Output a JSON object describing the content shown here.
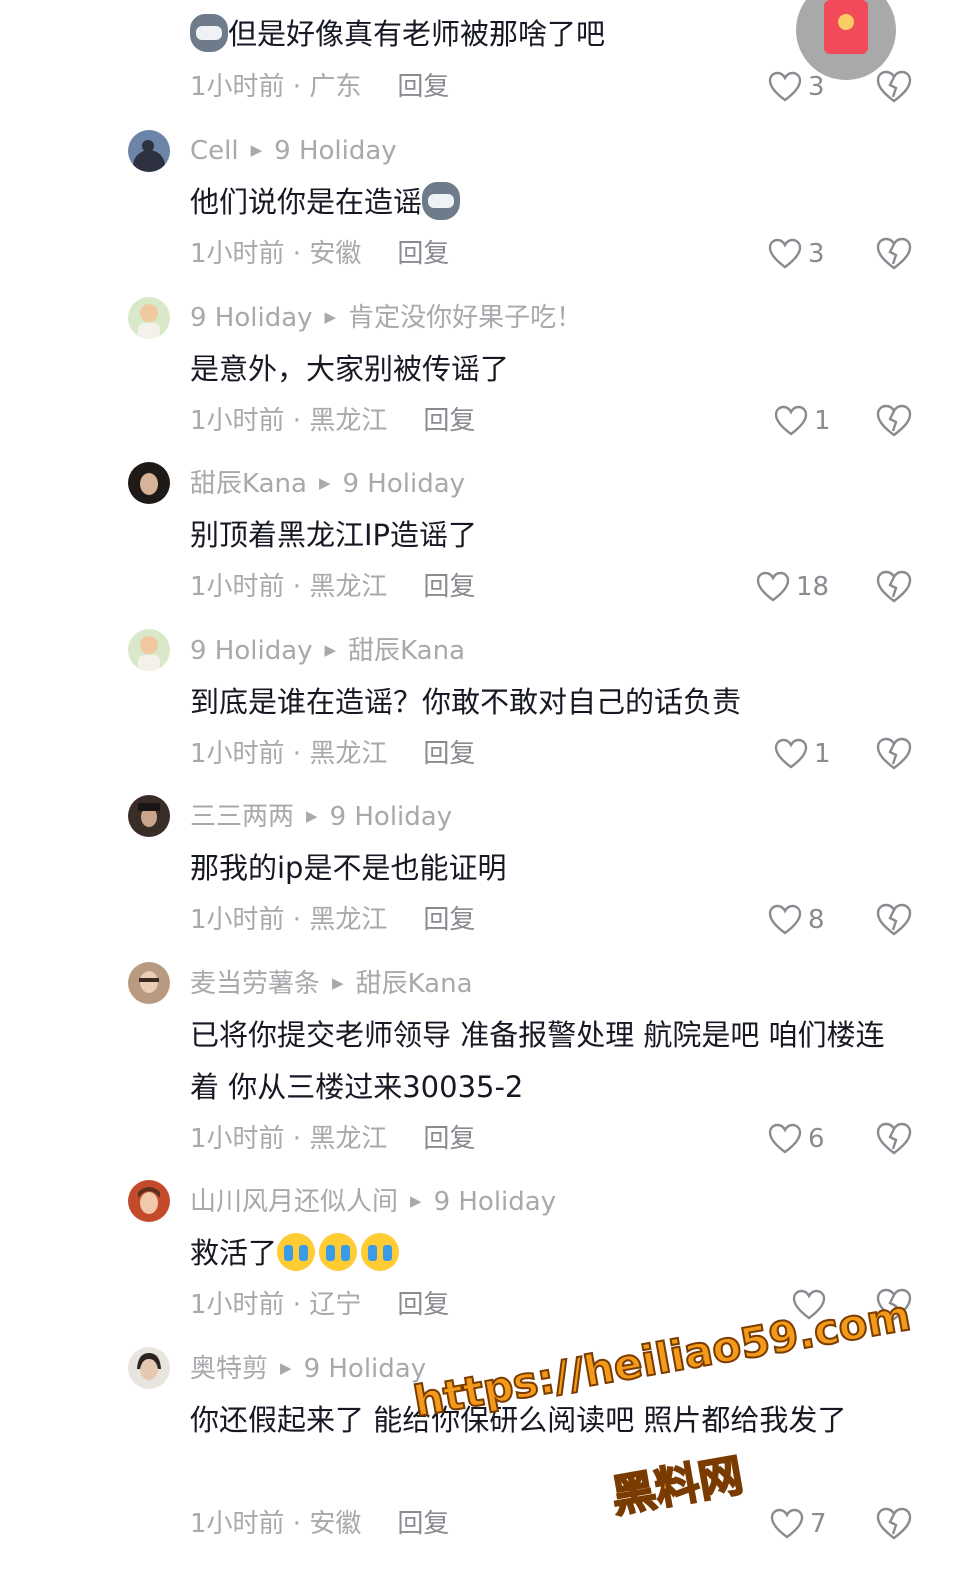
{
  "red_packet_icon": "red-envelope-icon",
  "colors": {
    "meta": "#a8a8ad",
    "text": "#161823",
    "watermark": "#f39a1a"
  },
  "comments": [
    {
      "text": "但是好像真有老师被那啥了吧",
      "leading_emoji": "cat-emoji",
      "time": "1小时前 · 广东",
      "reply": "回复",
      "likes": "3"
    },
    {
      "user": "Cell",
      "reply_to": "9 Holiday",
      "text": "他们说你是在造谣",
      "trailing_emoji": "cat-emoji",
      "time": "1小时前 · 安徽",
      "reply": "回复",
      "likes": "3"
    },
    {
      "user": "9 Holiday",
      "reply_to": "肯定没你好果子吃！",
      "text": "是意外，大家别被传谣了",
      "time": "1小时前 · 黑龙江",
      "reply": "回复",
      "likes": "1"
    },
    {
      "user": "甜辰Kana",
      "reply_to": "9 Holiday",
      "text": "别顶着黑龙江IP造谣了",
      "time": "1小时前 · 黑龙江",
      "reply": "回复",
      "likes": "18"
    },
    {
      "user": "9 Holiday",
      "reply_to": "甜辰Kana",
      "text": "到底是谁在造谣？你敢不敢对自己的话负责",
      "time": "1小时前 · 黑龙江",
      "reply": "回复",
      "likes": "1"
    },
    {
      "user": "三三两两",
      "reply_to": "9 Holiday",
      "text": "那我的ip是不是也能证明",
      "time": "1小时前 · 黑龙江",
      "reply": "回复",
      "likes": "8"
    },
    {
      "user": "麦当劳薯条",
      "reply_to": "甜辰Kana",
      "text": "已将你提交老师领导  准备报警处理 航院是吧 咱们楼连着 你从三楼过来30035-2",
      "time": "1小时前 · 黑龙江",
      "reply": "回复",
      "likes": "6"
    },
    {
      "user": "山川风月还似人间",
      "reply_to": "9 Holiday",
      "text": "救活了",
      "trailing_emoji": "crying-emoji x3",
      "time": "1小时前 · 辽宁",
      "reply": "回复",
      "likes": ""
    },
    {
      "user": "奥特剪",
      "reply_to": "9 Holiday",
      "text": "你还假起来了 能给你保研么阅读吧 照片都给我发了",
      "time": "1小时前 · 安徽",
      "reply": "回复",
      "likes": "7"
    }
  ],
  "watermark": {
    "url": "https://heiliao59.com",
    "name": "黑料网"
  }
}
